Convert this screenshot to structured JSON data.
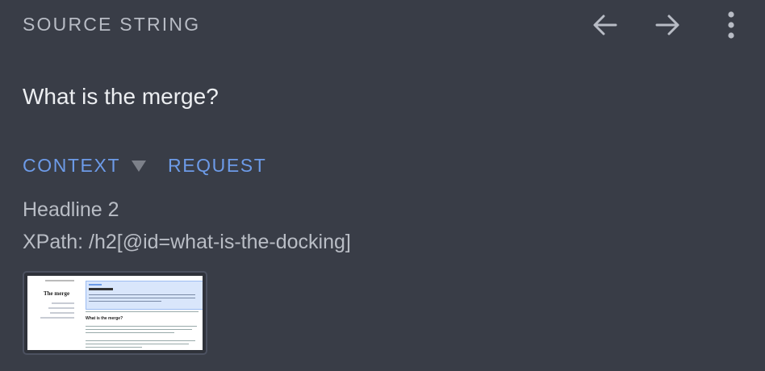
{
  "header": {
    "label": "SOURCE STRING",
    "icons": {
      "back": "arrow-left-icon",
      "forward": "arrow-right-icon",
      "more": "more-vertical-icon"
    }
  },
  "source": {
    "text": "What is the merge?"
  },
  "tabs": [
    {
      "label": "CONTEXT",
      "active": true,
      "has_dropdown": true
    },
    {
      "label": "REQUEST",
      "active": false
    }
  ],
  "context": {
    "line1": "Headline 2",
    "line2": "XPath: /h2[@id=what-is-the-docking]"
  },
  "screenshot_thumbnail": {
    "heading": "The merge",
    "subheading": "What is the merge?"
  },
  "colors": {
    "background": "#393d47",
    "accent": "#6d9be8",
    "muted_text": "#b8bcc5",
    "primary_text": "#eceef1"
  }
}
